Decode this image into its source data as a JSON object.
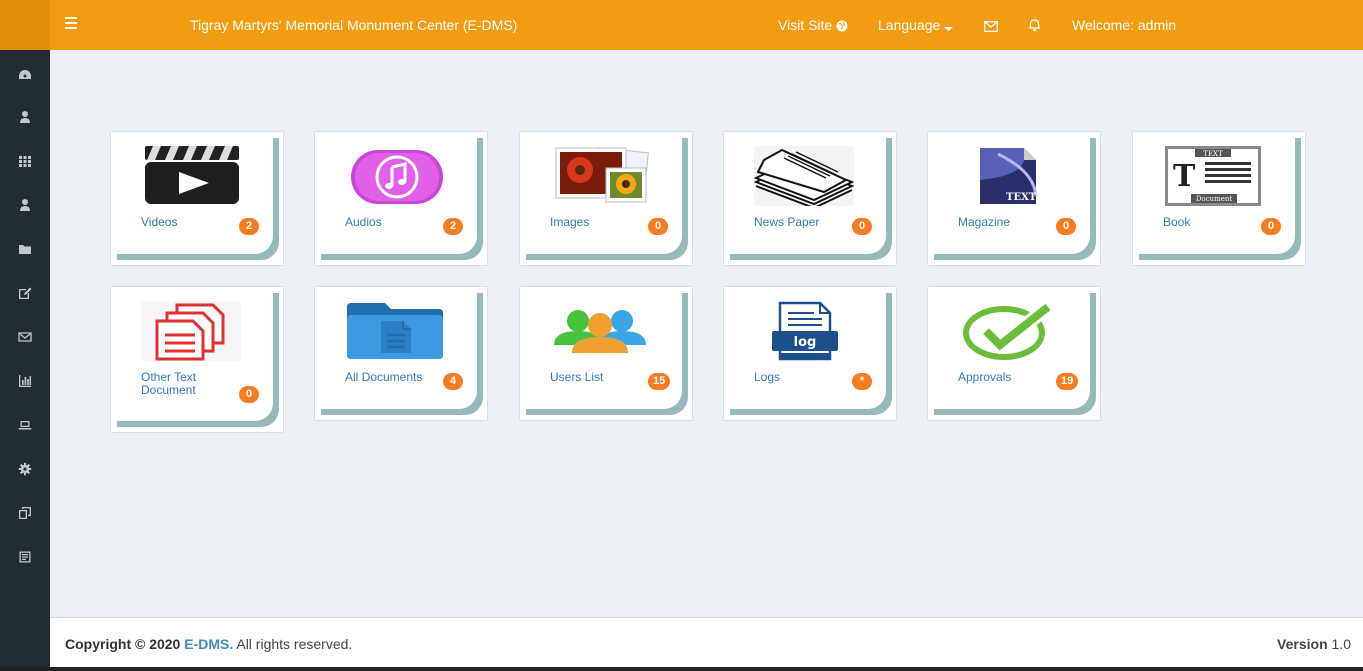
{
  "header": {
    "app_title": "Tigray Martyrs' Memorial Monument Center (E-DMS)",
    "visit_site": "Visit Site",
    "language": "Language",
    "welcome": "Welcome: admin"
  },
  "colors": {
    "brand": "#f39c12",
    "sidebar": "#222d32",
    "badge": "#f57c1f",
    "link": "#337ab7"
  },
  "sidebar": {
    "icons": [
      "dashboard-icon",
      "user-icon",
      "apps-grid-icon",
      "user-icon",
      "folder-icon",
      "edit-icon",
      "mail-icon",
      "bar-chart-icon",
      "laptop-icon",
      "settings-gear-icon",
      "copy-icon",
      "archive-icon"
    ]
  },
  "tiles": [
    {
      "label": "Videos",
      "count": "2",
      "icon": "video-clapper-icon"
    },
    {
      "label": "Audios",
      "count": "2",
      "icon": "music-note-icon"
    },
    {
      "label": "Images",
      "count": "0",
      "icon": "photo-stack-icon"
    },
    {
      "label": "News Paper",
      "count": "0",
      "icon": "newspaper-icon"
    },
    {
      "label": "Magazine",
      "count": "0",
      "icon": "magazine-text-icon"
    },
    {
      "label": "Book",
      "count": "0",
      "icon": "book-text-document-icon"
    },
    {
      "label": "Other Text Document",
      "count": "0",
      "icon": "text-documents-icon"
    },
    {
      "label": "All Documents",
      "count": "4",
      "icon": "folder-documents-icon"
    },
    {
      "label": "Users List",
      "count": "15",
      "icon": "users-group-icon"
    },
    {
      "label": "Logs",
      "count": "*",
      "icon": "log-file-icon"
    },
    {
      "label": "Approvals",
      "count": "19",
      "icon": "check-mark-icon"
    }
  ],
  "icon_texts": {
    "log": "log",
    "text": "TEXT",
    "document": "Document",
    "t": "T"
  },
  "footer": {
    "copyright": "Copyright © 2020",
    "brand": "E-DMS.",
    "rights": "All rights reserved.",
    "version_label": "Version",
    "version": "1.0"
  }
}
